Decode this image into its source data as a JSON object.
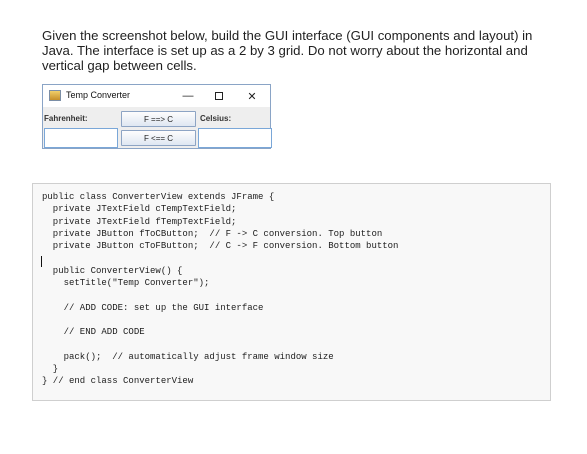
{
  "question": {
    "line1": "Given the screenshot below, build the GUI interface (GUI components and layout) in",
    "line2": "Java.  The interface is set up as a 2 by 3 grid. Do not worry about the horizontal and",
    "line3": "vertical gap between cells."
  },
  "window": {
    "title": "Temp Converter",
    "minimize_glyph": "—",
    "close_glyph": "✕",
    "fahrenheit_label": "Fahrenheit:",
    "celsius_label": "Celsius:",
    "f_to_c_button": "F ==> C",
    "c_to_f_button": "F <== C",
    "fahrenheit_value": "",
    "celsius_value": ""
  },
  "code": {
    "lines": [
      "public class ConverterView extends JFrame {",
      "  private JTextField cTempTextField;",
      "  private JTextField fTempTextField;",
      "  private JButton fToCButton;  // F -> C conversion. Top button",
      "  private JButton cToFButton;  // C -> F conversion. Bottom button",
      "",
      "  public ConverterView() {",
      "    setTitle(\"Temp Converter\");",
      "",
      "    // ADD CODE: set up the GUI interface",
      "",
      "    // END ADD CODE",
      "",
      "    pack();  // automatically adjust frame window size",
      "  }",
      "} // end class ConverterView"
    ]
  }
}
